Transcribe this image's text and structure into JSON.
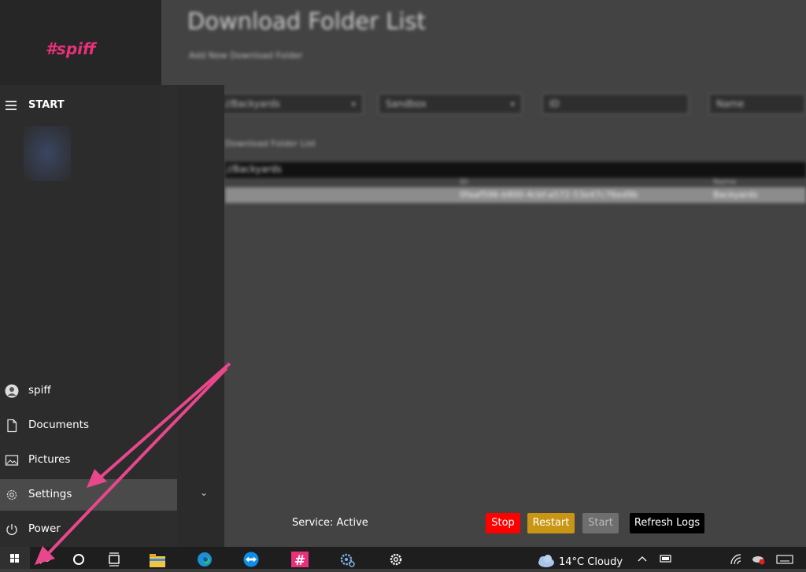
{
  "app": {
    "logo": "#spiff",
    "title": "Download Folder List",
    "subtitle": "Add New Download Folder",
    "selects": [
      "//Backyards",
      "Sandbox"
    ],
    "inputs": [
      {
        "placeholder": "ID"
      },
      {
        "placeholder": "Name"
      }
    ],
    "folder_list_label": "Download Folder List",
    "table": {
      "header": "//Backyards",
      "columns": [
        "ID",
        "Name"
      ],
      "rows": [
        {
          "id": "0faaf596-b900-4cbf-a572-53e47c76ed9b",
          "name": "Backyards"
        }
      ]
    },
    "service_status": "Service: Active",
    "buttons": {
      "stop": "Stop",
      "restart": "Restart",
      "start": "Start",
      "refresh": "Refresh Logs"
    },
    "colors": {
      "stop": "#ff0000",
      "restart": "#c99514",
      "start": "#6e6e6e",
      "refresh": "#000000",
      "accent": "#e8317a"
    }
  },
  "start_menu": {
    "title": "START",
    "items": [
      {
        "label": "spiff",
        "icon": "user-icon"
      },
      {
        "label": "Documents",
        "icon": "document-icon"
      },
      {
        "label": "Pictures",
        "icon": "pictures-icon"
      },
      {
        "label": "Settings",
        "icon": "gear-icon"
      },
      {
        "label": "Power",
        "icon": "power-icon"
      }
    ]
  },
  "taskbar": {
    "weather": "14°C  Cloudy",
    "icons": [
      "windows-start-icon",
      "search-icon",
      "cortana-icon",
      "task-view-icon",
      "file-explorer-icon",
      "edge-icon",
      "teamviewer-icon",
      "spiff-app-icon",
      "service-gear-icon",
      "settings-icon"
    ]
  },
  "annotation": {
    "arrow_color": "#e8478b"
  }
}
